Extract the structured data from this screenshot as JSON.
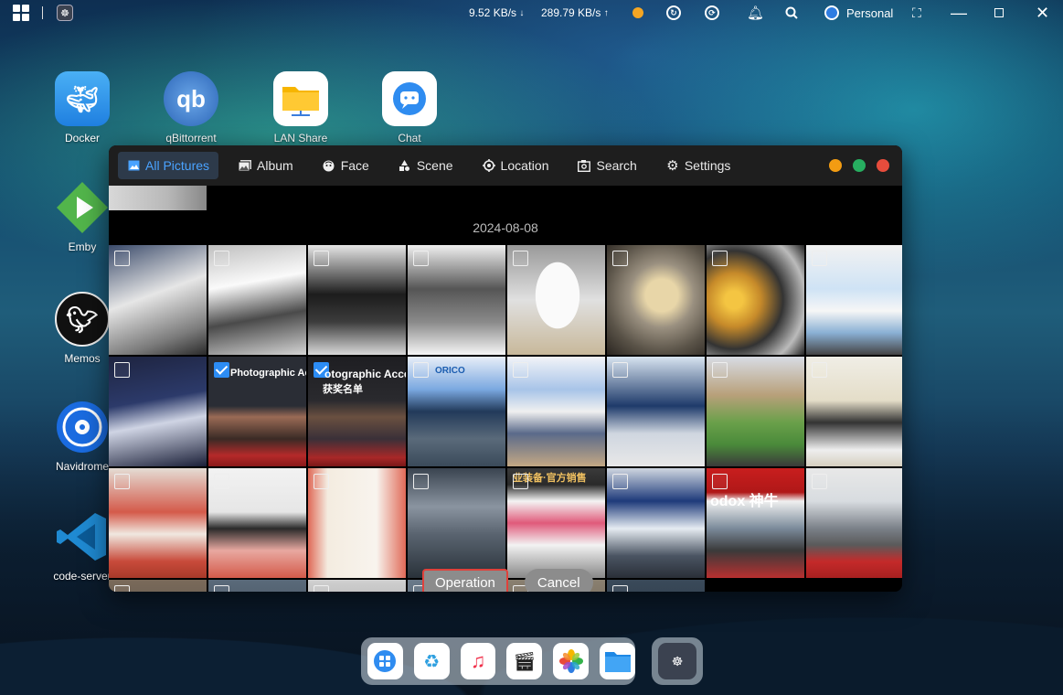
{
  "topbar": {
    "download_speed": "9.52 KB/s",
    "download_arrow": "↓",
    "upload_speed": "289.79 KB/s",
    "upload_arrow": "↑",
    "user_name": "Personal"
  },
  "desktop_icons": [
    {
      "label": "Docker"
    },
    {
      "label": "qBittorrent",
      "glyph": "qb"
    },
    {
      "label": "LAN Share"
    },
    {
      "label": "Chat"
    },
    {
      "label": "Emby"
    },
    {
      "label": "Memos"
    },
    {
      "label": "Navidrome"
    },
    {
      "label": "code-server"
    }
  ],
  "photos": {
    "tabs": [
      {
        "label": "All Pictures",
        "icon": "image-icon",
        "active": true
      },
      {
        "label": "Album",
        "icon": "album-icon"
      },
      {
        "label": "Face",
        "icon": "face-icon"
      },
      {
        "label": "Scene",
        "icon": "scene-icon"
      },
      {
        "label": "Location",
        "icon": "location-icon"
      },
      {
        "label": "Search",
        "icon": "search-icon"
      },
      {
        "label": "Settings",
        "icon": "gear-icon"
      }
    ],
    "window_controls": {
      "minimize": "#f39c12",
      "maximize": "#27ae60",
      "close": "#e74c3c"
    },
    "date_header": "2024-08-08",
    "photo_texts": {
      "p_a": "Photographic Accesso",
      "p_b": "otographic Acce",
      "p_c": "获奖名单",
      "p_d": "ORICO",
      "p_e": "odox 神牛",
      "p_f": "业装备·官方销售"
    },
    "selected_count": 2,
    "operation_button": "Operation",
    "cancel_button": "Cancel"
  },
  "colors": {
    "accent": "#2c8cf4",
    "active_tab_text": "#4aa3ff",
    "operation_border": "#e0413b"
  }
}
